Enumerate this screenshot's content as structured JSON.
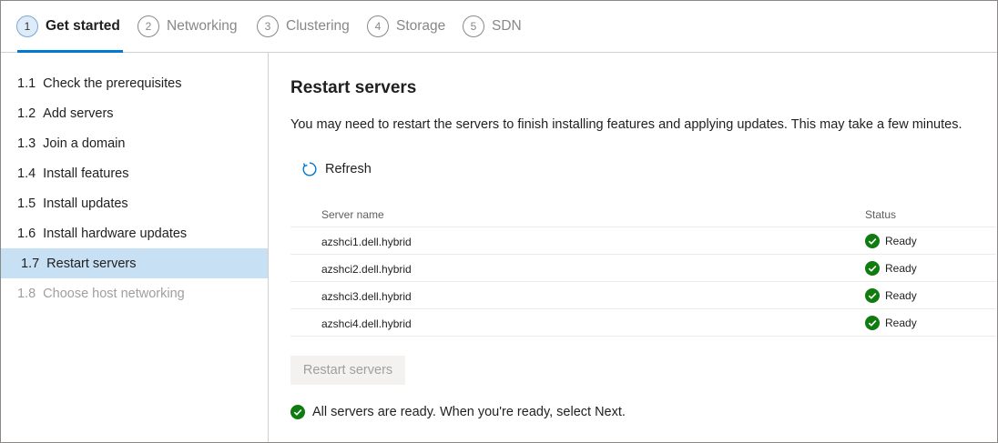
{
  "stepper": {
    "steps": [
      {
        "num": "1",
        "label": "Get started"
      },
      {
        "num": "2",
        "label": "Networking"
      },
      {
        "num": "3",
        "label": "Clustering"
      },
      {
        "num": "4",
        "label": "Storage"
      },
      {
        "num": "5",
        "label": "SDN"
      }
    ],
    "active_index": 0
  },
  "sidebar": {
    "items": [
      {
        "num": "1.1",
        "label": "Check the prerequisites"
      },
      {
        "num": "1.2",
        "label": "Add servers"
      },
      {
        "num": "1.3",
        "label": "Join a domain"
      },
      {
        "num": "1.4",
        "label": "Install features"
      },
      {
        "num": "1.5",
        "label": "Install updates"
      },
      {
        "num": "1.6",
        "label": "Install hardware updates"
      },
      {
        "num": "1.7",
        "label": "Restart servers"
      },
      {
        "num": "1.8",
        "label": "Choose host networking"
      }
    ],
    "selected_index": 6,
    "disabled_index": 7
  },
  "main": {
    "title": "Restart servers",
    "description": "You may need to restart the servers to finish installing features and applying updates. This may take a few minutes.",
    "refresh_label": "Refresh",
    "table": {
      "headers": {
        "name": "Server name",
        "status": "Status"
      },
      "rows": [
        {
          "name": "azshci1.dell.hybrid",
          "status": "Ready"
        },
        {
          "name": "azshci2.dell.hybrid",
          "status": "Ready"
        },
        {
          "name": "azshci3.dell.hybrid",
          "status": "Ready"
        },
        {
          "name": "azshci4.dell.hybrid",
          "status": "Ready"
        }
      ]
    },
    "restart_button_label": "Restart servers",
    "footer_message": "All servers are ready. When you're ready, select Next."
  },
  "colors": {
    "accent": "#0078d4",
    "success": "#107c10",
    "selected_bg": "#c7e0f4"
  },
  "icons": {
    "refresh": "refresh-icon",
    "status_ok": "check-circle-icon"
  }
}
